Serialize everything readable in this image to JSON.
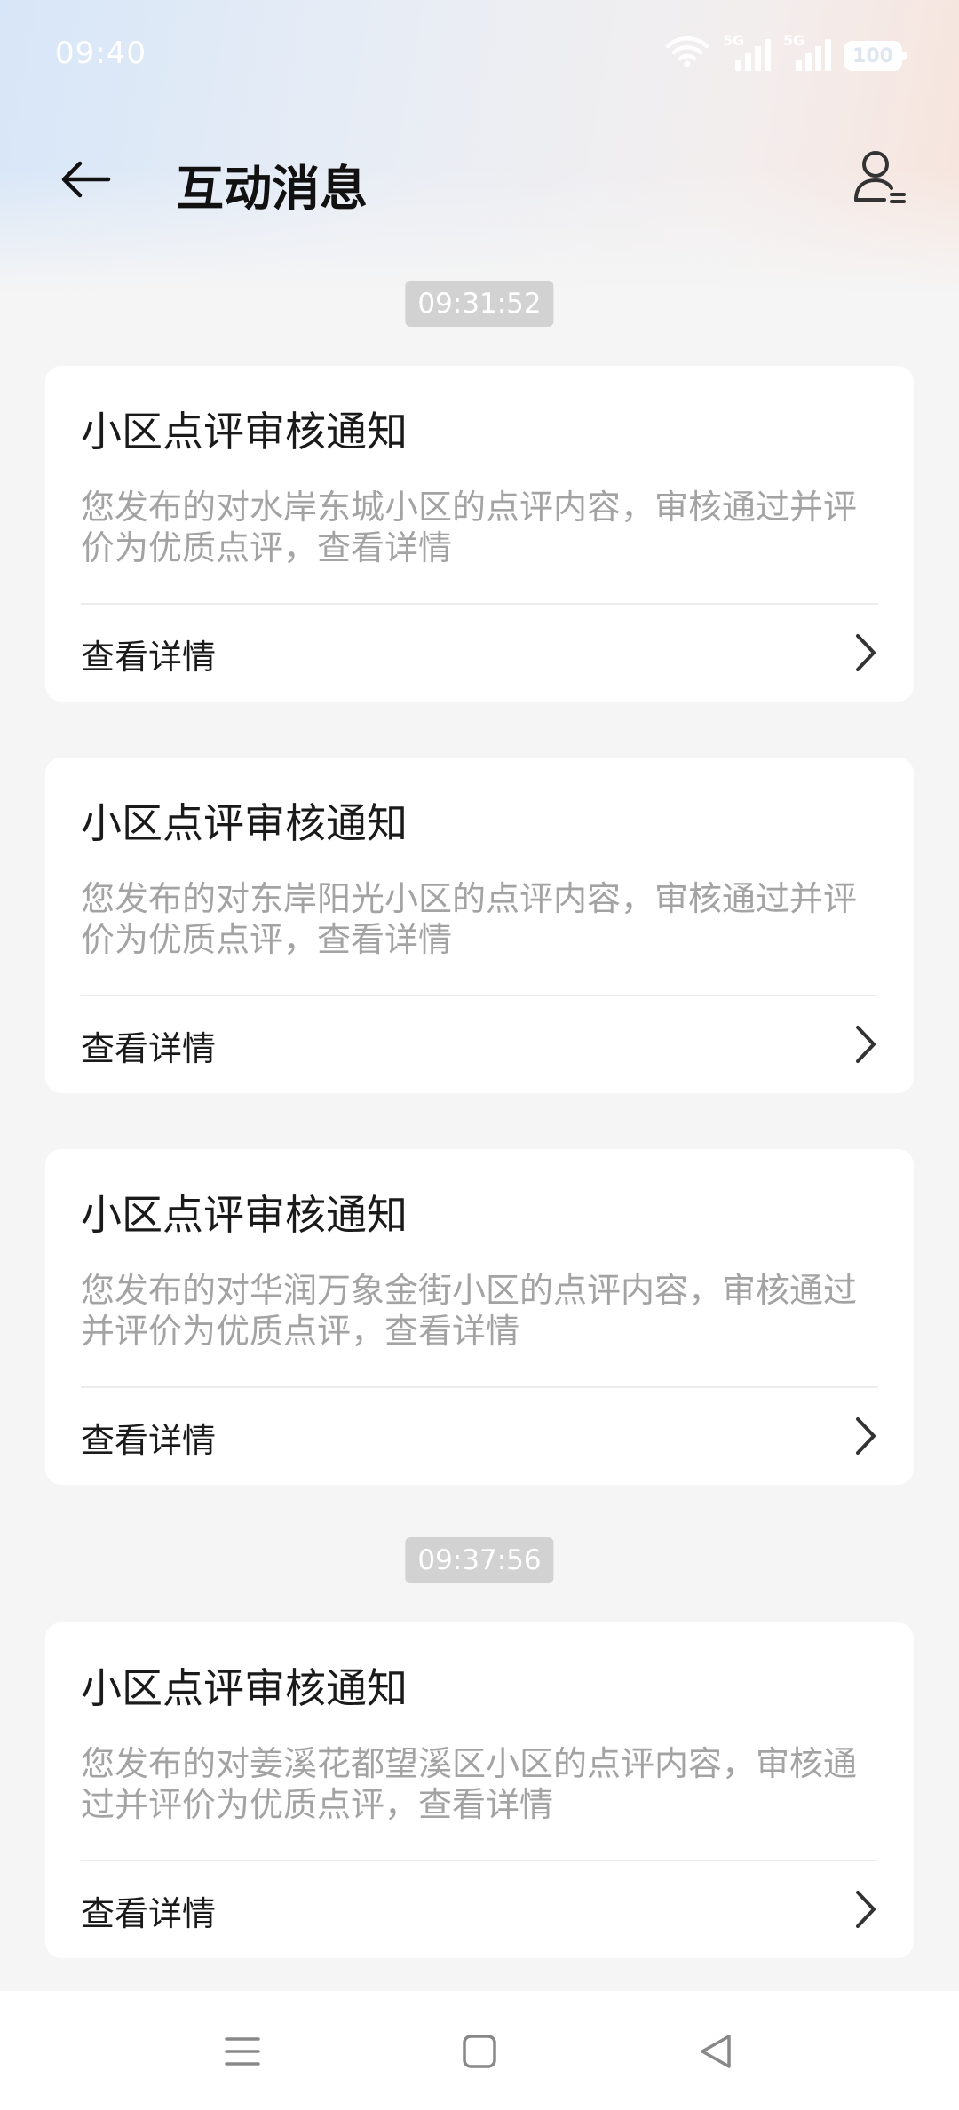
{
  "status_bar": {
    "time": "09:40",
    "network_tag_1": "5G",
    "network_tag_2": "5G",
    "battery": "100",
    "icons": [
      "wifi-icon",
      "signal-5g-icon",
      "signal-5g-icon",
      "battery-icon"
    ]
  },
  "header": {
    "title": "互动消息",
    "back_icon": "arrow-left-icon",
    "profile_icon": "user-settings-icon"
  },
  "timestamps": [
    "09:31:52",
    "09:37:56"
  ],
  "cards": [
    {
      "title": "小区点评审核通知",
      "body": "您发布的对水岸东城小区的点评内容，审核通过并评价为优质点评，查看详情",
      "link": "查看详情"
    },
    {
      "title": "小区点评审核通知",
      "body": "您发布的对东岸阳光小区的点评内容，审核通过并评价为优质点评，查看详情",
      "link": "查看详情"
    },
    {
      "title": "小区点评审核通知",
      "body": "您发布的对华润万象金街小区的点评内容，审核通过并评价为优质点评，查看详情",
      "link": "查看详情"
    },
    {
      "title": "小区点评审核通知",
      "body": "您发布的对姜溪花都望溪区小区的点评内容，审核通过并评价为优质点评，查看详情",
      "link": "查看详情"
    }
  ],
  "nav": {
    "icons": [
      "menu-icon",
      "home-square-icon",
      "back-triangle-icon"
    ]
  }
}
